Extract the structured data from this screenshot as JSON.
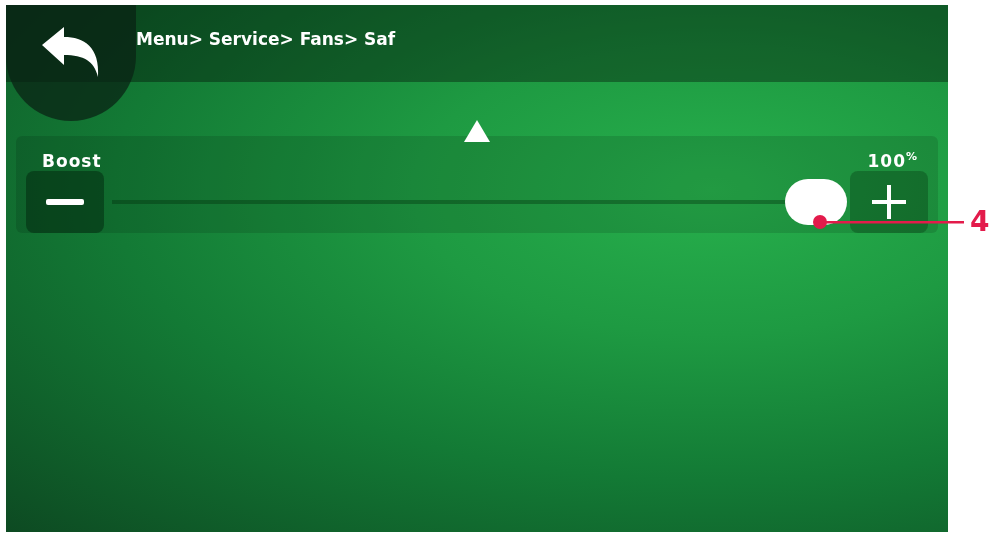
{
  "header": {
    "breadcrumb": "Menu> Service> Fans> Saf"
  },
  "slider": {
    "label": "Boost",
    "value": "100$^{%}$",
    "level": 1.0
  },
  "callout": {
    "label": "4"
  }
}
